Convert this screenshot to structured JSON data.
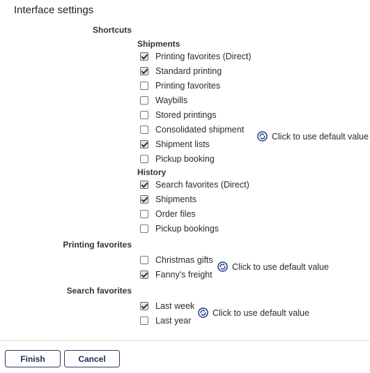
{
  "title": "Interface settings",
  "sections": {
    "shortcuts": {
      "label": "Shortcuts",
      "groups": {
        "shipments": {
          "label": "Shipments",
          "items": [
            {
              "label": "Printing favorites (Direct)",
              "checked": true
            },
            {
              "label": "Standard printing",
              "checked": true
            },
            {
              "label": "Printing favorites",
              "checked": false
            },
            {
              "label": "Waybills",
              "checked": false
            },
            {
              "label": "Stored printings",
              "checked": false
            },
            {
              "label": "Consolidated shipment",
              "checked": false
            },
            {
              "label": "Shipment lists",
              "checked": true
            },
            {
              "label": "Pickup booking",
              "checked": false
            }
          ]
        },
        "history": {
          "label": "History",
          "items": [
            {
              "label": "Search favorites (Direct)",
              "checked": true
            },
            {
              "label": "Shipments",
              "checked": true
            },
            {
              "label": "Order files",
              "checked": false
            },
            {
              "label": "Pickup bookings",
              "checked": false
            }
          ]
        }
      },
      "default_label": "Click to use default value"
    },
    "printing_favorites": {
      "label": "Printing favorites",
      "items": [
        {
          "label": "Christmas gifts",
          "checked": false
        },
        {
          "label": "Fanny's freight",
          "checked": true
        }
      ],
      "default_label": "Click to use default value"
    },
    "search_favorites": {
      "label": "Search favorites",
      "items": [
        {
          "label": "Last week",
          "checked": true
        },
        {
          "label": "Last year",
          "checked": false
        }
      ],
      "default_label": "Click to use default value"
    }
  },
  "buttons": {
    "finish": "Finish",
    "cancel": "Cancel"
  },
  "colors": {
    "accent": "#1d2b55",
    "reset_icon": "#1f3a8f"
  },
  "icons": {
    "reset": "reset-default-icon"
  }
}
